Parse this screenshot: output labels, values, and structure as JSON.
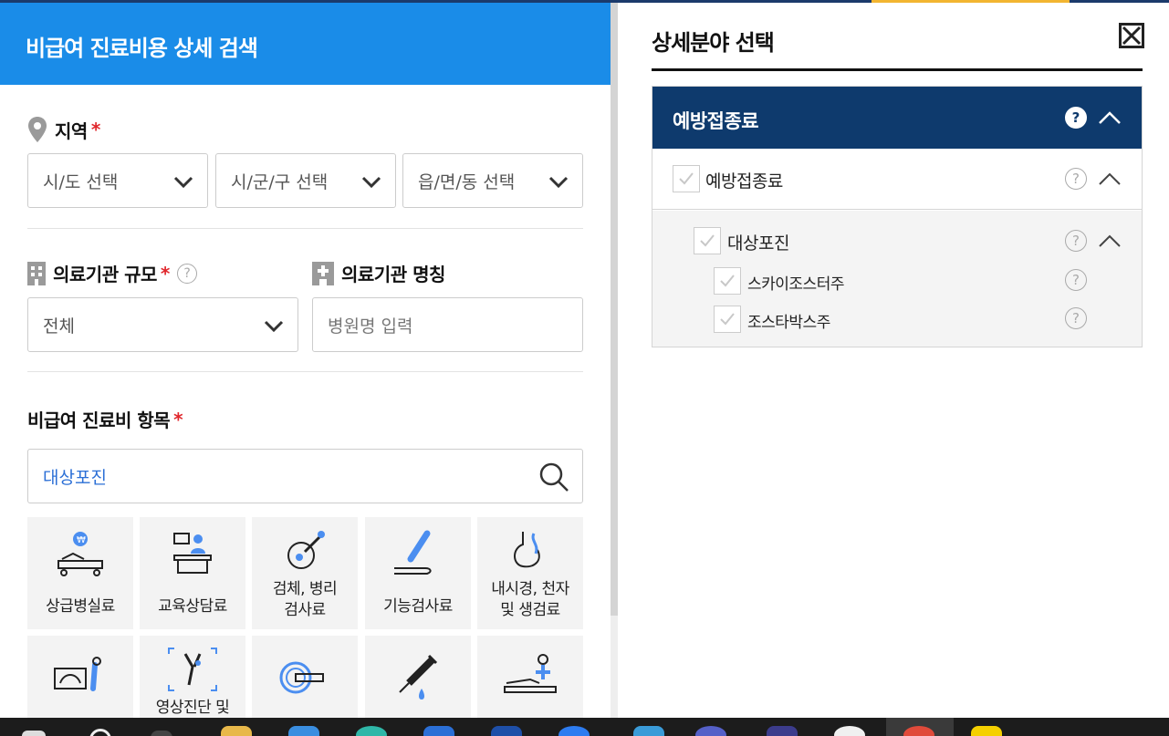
{
  "left": {
    "title": "비급여 진료비용 상세 검색",
    "region": {
      "label": "지역",
      "required": "*",
      "selects": [
        "시/도 선택",
        "시/군/구 선택",
        "읍/면/동 선택"
      ]
    },
    "scale": {
      "label": "의료기관 규모",
      "required": "*",
      "help": "?",
      "value": "전체"
    },
    "name": {
      "label": "의료기관 명칭",
      "placeholder": "병원명 입력"
    },
    "items": {
      "label": "비급여 진료비 항목",
      "required": "*",
      "search_value": "대상포진"
    },
    "tiles": [
      {
        "icon": "hospital-bed-icon",
        "label1": "상급병실료",
        "label2": ""
      },
      {
        "icon": "counseling-desk-icon",
        "label1": "교육상담료",
        "label2": ""
      },
      {
        "icon": "specimen-test-icon",
        "label1": "검체, 병리",
        "label2": "검사료"
      },
      {
        "icon": "function-test-icon",
        "label1": "기능검사료",
        "label2": ""
      },
      {
        "icon": "endoscope-icon",
        "label1": "내시경, 천자",
        "label2": "및 생검료"
      },
      {
        "icon": "ultrasound-icon",
        "label1": "",
        "label2": ""
      },
      {
        "icon": "xray-joint-icon",
        "label1": "영상진단 및",
        "label2": ""
      },
      {
        "icon": "mri-scanner-icon",
        "label1": "",
        "label2": ""
      },
      {
        "icon": "syringe-icon",
        "label1": "",
        "label2": ""
      },
      {
        "icon": "physical-therapy-icon",
        "label1": "",
        "label2": ""
      }
    ]
  },
  "right": {
    "title": "상세분야 선택",
    "close_icon": "close-box-icon",
    "category": "예방접종료",
    "level1": "예방접종료",
    "level2": "대상포진",
    "leaves": [
      "스카이조스터주",
      "조스타박스주"
    ],
    "help": "?"
  },
  "colors": {
    "header_blue": "#1a8ce8",
    "navy": "#0e3a6d",
    "required_red": "#e0262b",
    "accent_yellow": "#f2b531",
    "search_text_blue": "#2b6fd6"
  },
  "taskbar": {
    "icons": [
      "start-icon",
      "search-icon",
      "task-view-icon",
      "file-explorer-icon",
      "store-icon",
      "edge-icon",
      "app-icon",
      "word-icon",
      "messenger-icon",
      "mail-icon",
      "browser-icon",
      "app-icon-2",
      "app-icon-3",
      "chrome-icon",
      "kakaotalk-icon"
    ]
  }
}
